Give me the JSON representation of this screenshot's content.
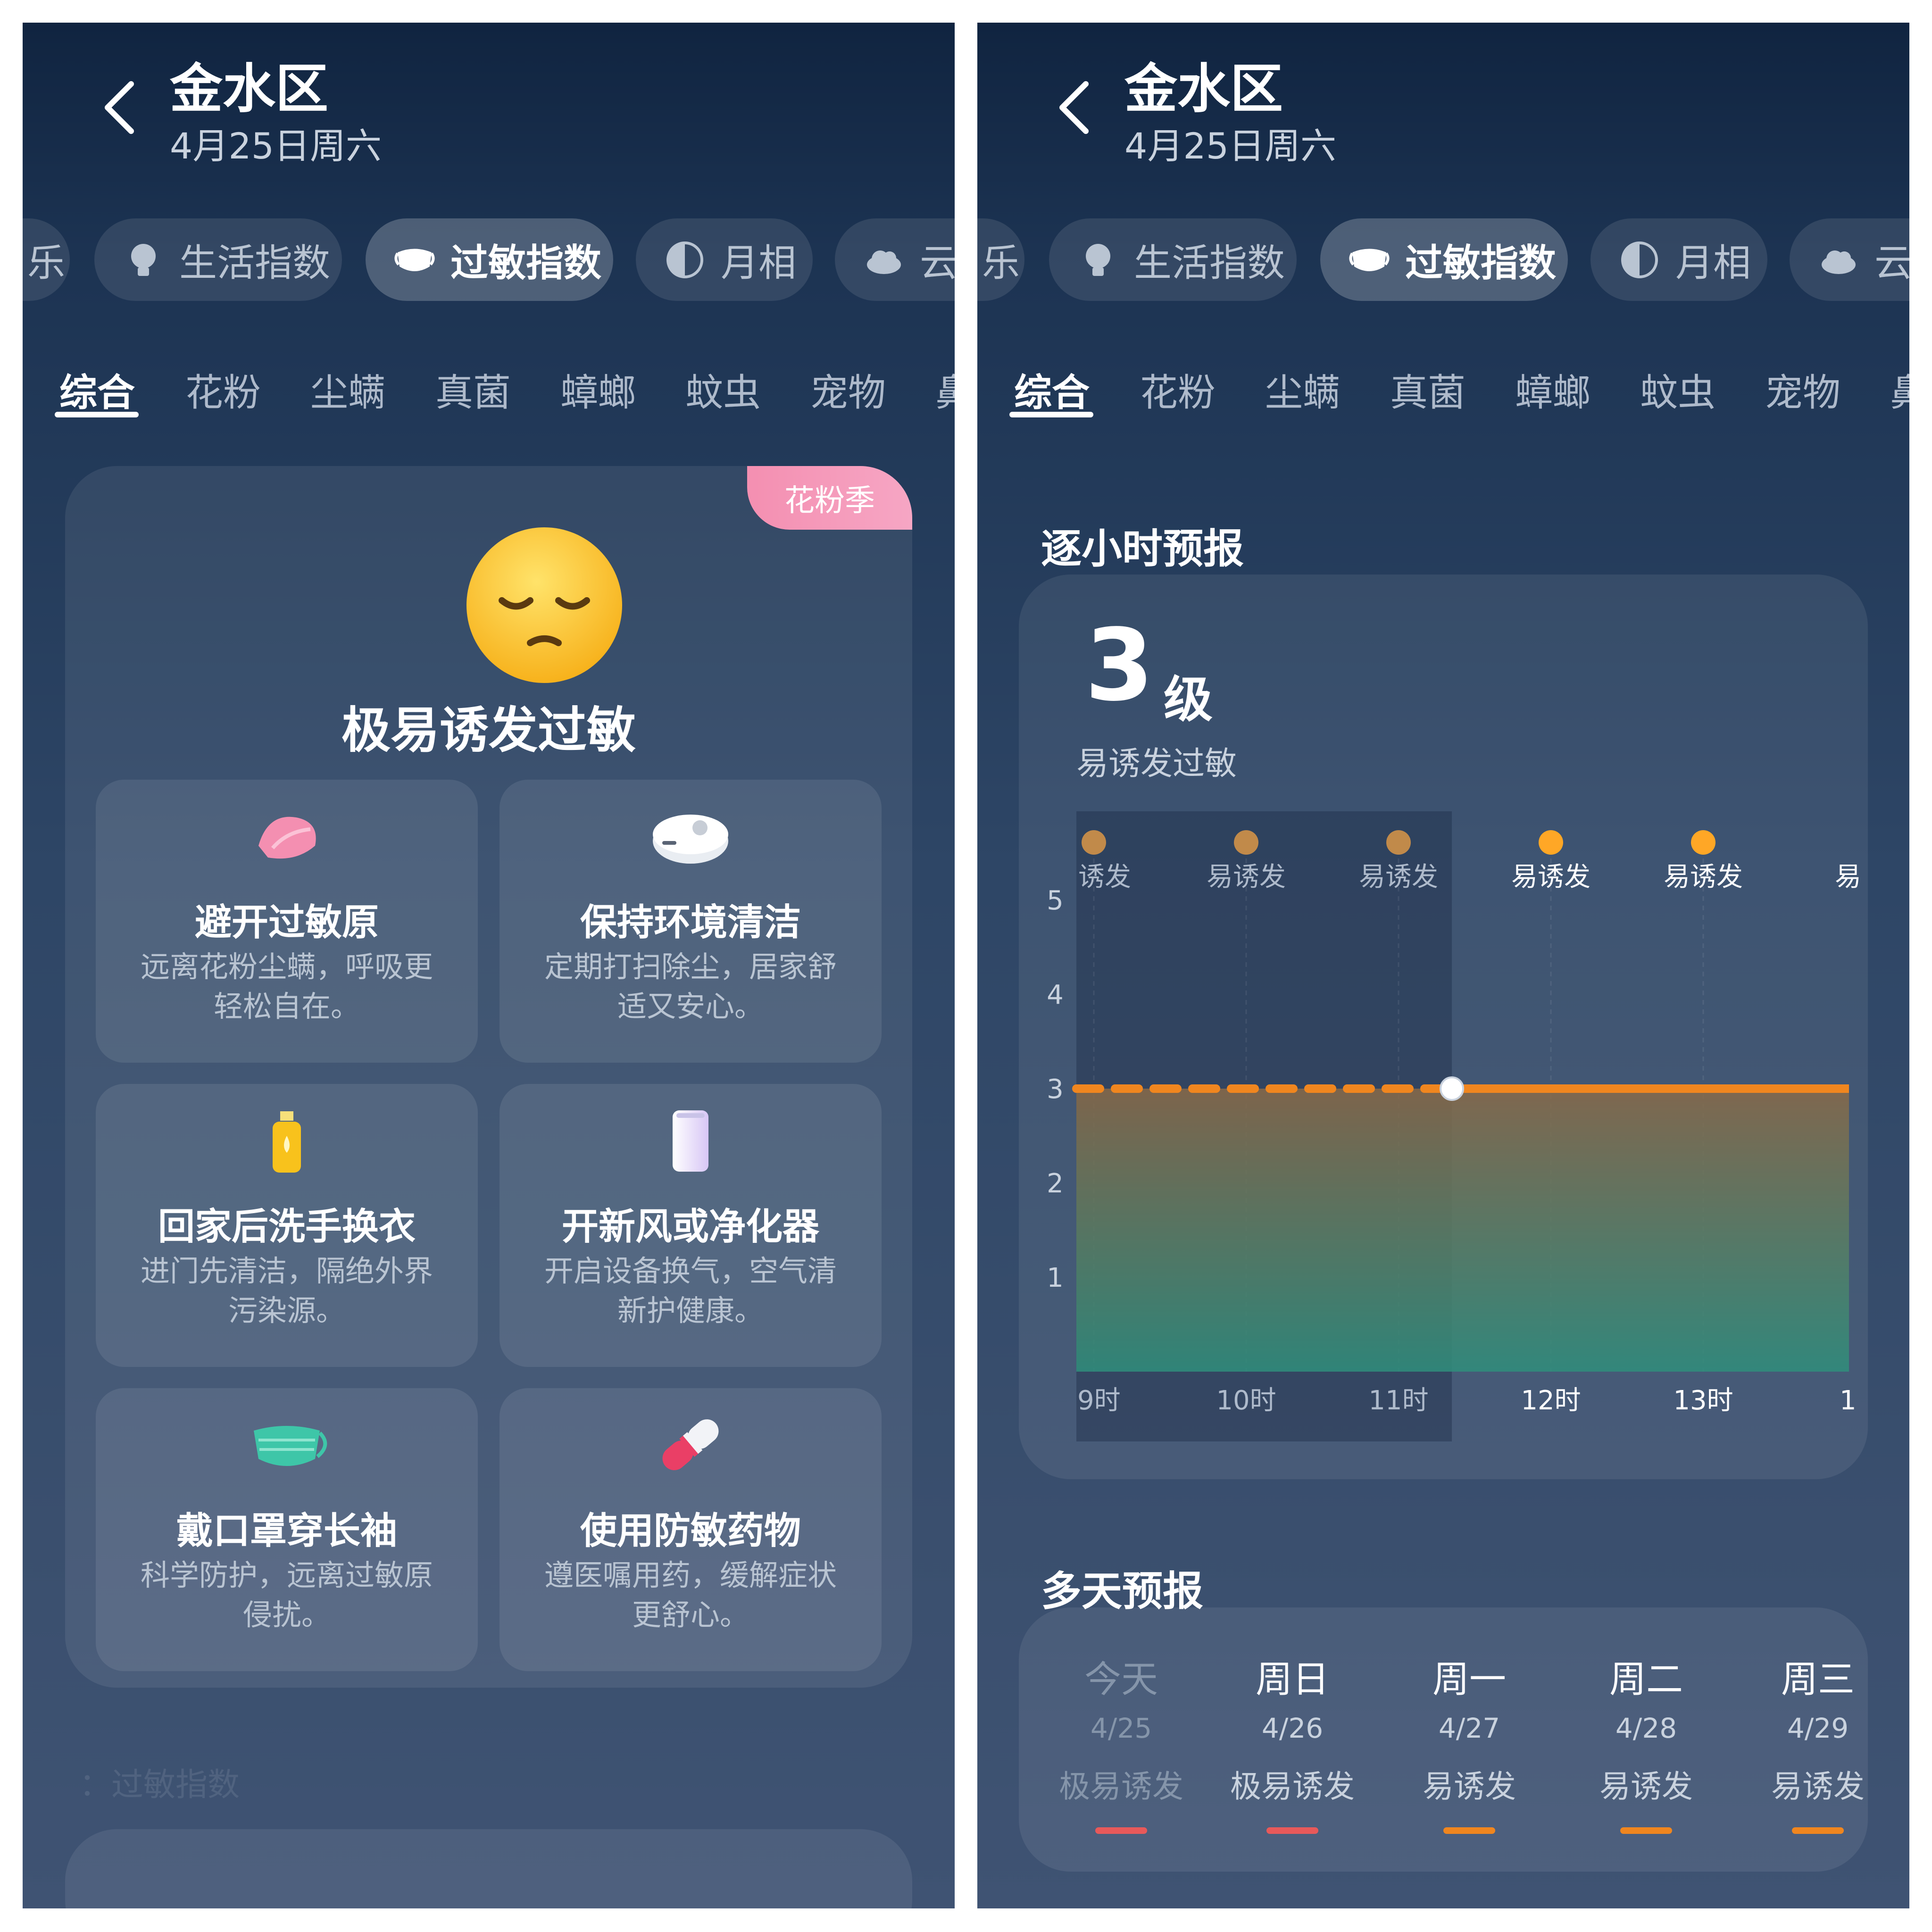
{
  "header": {
    "city": "金水区",
    "date": "4月25日周六"
  },
  "pills": [
    {
      "label": "乐",
      "icon": "partial-icon"
    },
    {
      "label": "生活指数",
      "icon": "lightbulb-icon"
    },
    {
      "label": "过敏指数",
      "icon": "mask-icon",
      "active": true
    },
    {
      "label": "月相",
      "icon": "moon-phase-icon"
    },
    {
      "label": "云",
      "icon": "cloud-icon"
    }
  ],
  "subtabs": [
    "综合",
    "花粉",
    "尘螨",
    "真菌",
    "蟑螂",
    "蚊虫",
    "宠物",
    "鼻"
  ],
  "left": {
    "badge": "花粉季",
    "headline": "极易诱发过敏",
    "tips": [
      {
        "title": "避开过敏原",
        "desc": "远离花粉尘螨，呼吸更轻松自在。",
        "icon": "petal-icon"
      },
      {
        "title": "保持环境清洁",
        "desc": "定期打扫除尘，居家舒适又安心。",
        "icon": "robot-vacuum-icon"
      },
      {
        "title": "回家后洗手换衣",
        "desc": "进门先清洁，隔绝外界污染源。",
        "icon": "soap-bottle-icon"
      },
      {
        "title": "开新风或净化器",
        "desc": "开启设备换气，空气清新护健康。",
        "icon": "air-purifier-icon"
      },
      {
        "title": "戴口罩穿长袖",
        "desc": "科学防护，远离过敏原侵扰。",
        "icon": "face-mask-icon"
      },
      {
        "title": "使用防敏药物",
        "desc": "遵医嘱用药，缓解症状更舒心。",
        "icon": "pill-capsule-icon"
      }
    ],
    "faint": "：过敏指数"
  },
  "right": {
    "hourly_title": "逐小时预报",
    "level_num": "3",
    "level_unit": "级",
    "level_desc": "易诱发过敏",
    "daily_title": "多天预报",
    "days": [
      {
        "name": "今天",
        "date": "4/25",
        "level": "极易诱发",
        "color": "#e8595a"
      },
      {
        "name": "周日",
        "date": "4/26",
        "level": "极易诱发",
        "color": "#e8595a"
      },
      {
        "name": "周一",
        "date": "4/27",
        "level": "易诱发",
        "color": "#f0861f"
      },
      {
        "name": "周二",
        "date": "4/28",
        "level": "易诱发",
        "color": "#f0861f"
      },
      {
        "name": "周三",
        "date": "4/29",
        "level": "易诱发",
        "color": "#f0861f"
      }
    ]
  },
  "chart_data": {
    "type": "line",
    "x": [
      "9时",
      "10时",
      "11时",
      "12时",
      "13时",
      "1"
    ],
    "series": [
      {
        "values": [
          3,
          3,
          3,
          3,
          3,
          3
        ]
      }
    ],
    "point_labels": [
      "诱发",
      "易诱发",
      "易诱发",
      "易诱发",
      "易诱发",
      "易"
    ],
    "ylim": [
      0,
      5
    ],
    "yticks": [
      "1",
      "2",
      "3",
      "4",
      "5"
    ],
    "current_index": 2.35,
    "past_color": "#c18a4a",
    "future_color": "#ffa726",
    "line_color": "#f0861f"
  }
}
